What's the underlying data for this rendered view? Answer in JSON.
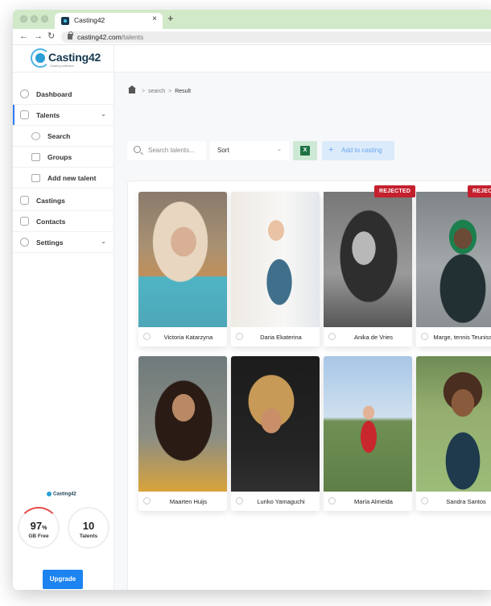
{
  "browser": {
    "tab_title": "Casting42",
    "url_host": "casting42.com",
    "url_path": "/talents"
  },
  "sidebar": {
    "logo_text": "Casting42",
    "logo_subtext": "Casting software",
    "nav": {
      "dashboard": "Dashboard",
      "talents": "Talents",
      "search": "Search",
      "groups": "Groups",
      "add_new_talent": "Add new talent",
      "castings": "Castings",
      "contacts": "Contacts",
      "settings": "Settings"
    },
    "mini_logo": "Casting42",
    "storage": {
      "value": "97",
      "unit": "%",
      "label": "GB Free",
      "fraction_used": 0.03
    },
    "talents": {
      "value": "10",
      "label": "Talents"
    },
    "upgrade_label": "Upgrade"
  },
  "breadcrumb": {
    "items": [
      "search",
      "Result"
    ]
  },
  "toolbar": {
    "search_placeholder": "Search talents...",
    "sort_label": "Sort",
    "excel_label": "X",
    "add_to_casting_label": "Add to casting"
  },
  "status_badge_text": "REJECTED",
  "status_badge_color": "#c4202e",
  "accent_color": "#1c83f0",
  "talents": [
    {
      "name": "Victoria Katarzyna",
      "status": ""
    },
    {
      "name": "Daria Ekaterina",
      "status": ""
    },
    {
      "name": "Anika de Vries",
      "status": "REJECTED"
    },
    {
      "name": "Marge, tennis Teunissen",
      "status": "REJECTED"
    },
    {
      "name": "Maarten Huijs",
      "status": ""
    },
    {
      "name": "Luriko Yamaguchi",
      "status": ""
    },
    {
      "name": "María Almeida",
      "status": ""
    },
    {
      "name": "Sandra Santos",
      "status": ""
    }
  ]
}
